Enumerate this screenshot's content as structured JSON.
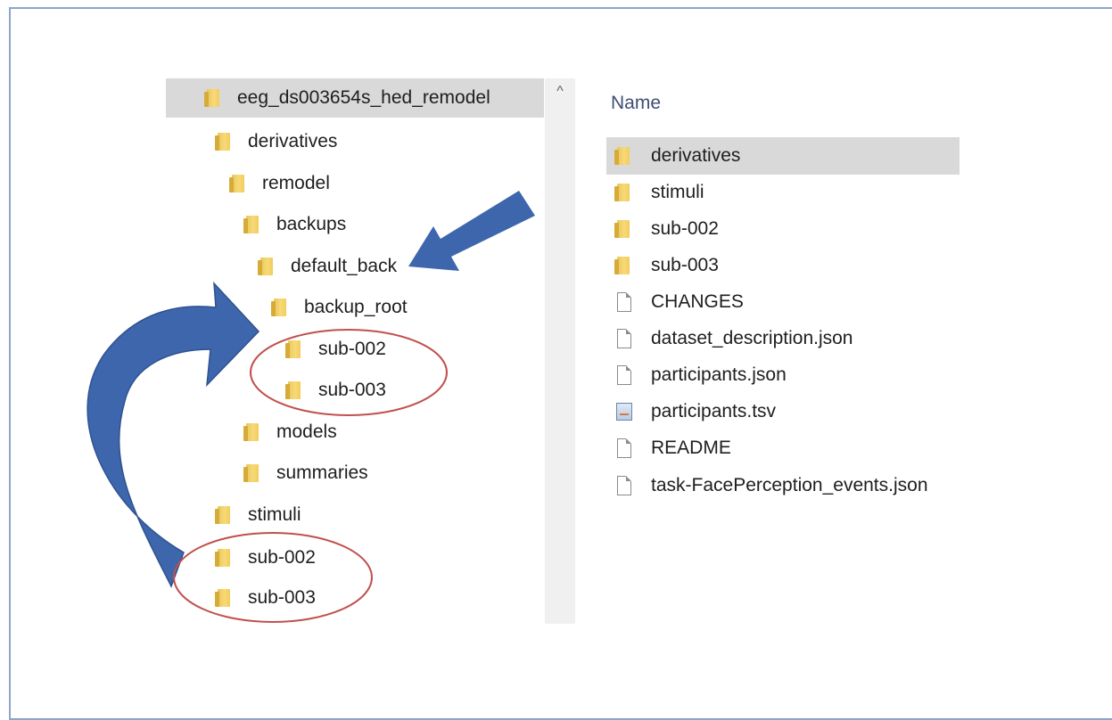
{
  "tree": {
    "items": [
      {
        "label": "eeg_ds003654s_hed_remodel",
        "selected": true
      },
      {
        "label": "derivatives"
      },
      {
        "label": "remodel"
      },
      {
        "label": "backups"
      },
      {
        "label": "default_back"
      },
      {
        "label": "backup_root"
      },
      {
        "label": "sub-002"
      },
      {
        "label": "sub-003"
      },
      {
        "label": "models"
      },
      {
        "label": "summaries"
      },
      {
        "label": "stimuli"
      },
      {
        "label": "sub-002"
      },
      {
        "label": "sub-003"
      }
    ]
  },
  "scrollbar": {
    "up_icon": "chevron-up-icon",
    "glyph": "^"
  },
  "file_list": {
    "column_header": "Name",
    "items": [
      {
        "label": "derivatives",
        "icon": "folder-icon",
        "selected": true
      },
      {
        "label": "stimuli",
        "icon": "folder-icon"
      },
      {
        "label": "sub-002",
        "icon": "folder-icon"
      },
      {
        "label": "sub-003",
        "icon": "folder-icon"
      },
      {
        "label": "CHANGES",
        "icon": "document-icon"
      },
      {
        "label": "dataset_description.json",
        "icon": "document-icon"
      },
      {
        "label": "participants.json",
        "icon": "document-icon"
      },
      {
        "label": "participants.tsv",
        "icon": "spreadsheet-icon"
      },
      {
        "label": "README",
        "icon": "document-icon"
      },
      {
        "label": "task-FacePerception_events.json",
        "icon": "document-icon"
      }
    ]
  },
  "annotations": {
    "arrow_color": "#3d66ad",
    "circle_color": "#c0504d",
    "frame_color": "#8ea4c9",
    "selection_color": "#d9d9d9"
  }
}
